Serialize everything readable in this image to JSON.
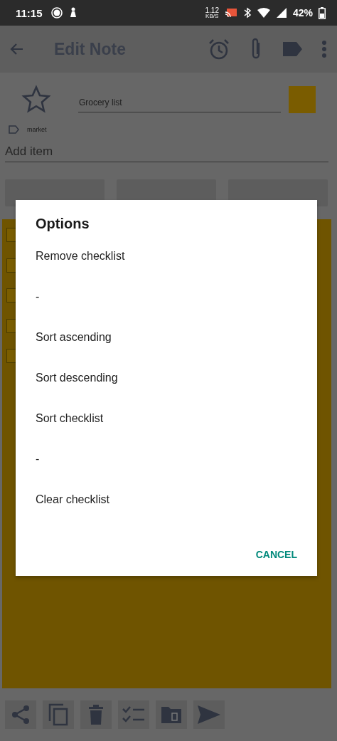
{
  "status_bar": {
    "time": "11:15",
    "speed": "1.12",
    "speed_unit": "KB/S",
    "battery": "42%"
  },
  "app_bar": {
    "title": "Edit Note"
  },
  "note": {
    "starred": false,
    "title": "Grocery list",
    "tag": "market",
    "add_item": {
      "placeholder": "Add item"
    },
    "checklist": [
      {
        "checked": false
      },
      {
        "checked": false
      },
      {
        "checked": false
      },
      {
        "checked": false
      },
      {
        "checked": false
      }
    ]
  },
  "dialog": {
    "title": "Options",
    "items": [
      "Remove checklist",
      "-",
      "Sort ascending",
      "Sort descending",
      "Sort checklist",
      "-",
      "Clear checklist"
    ],
    "button": "CANCEL"
  }
}
